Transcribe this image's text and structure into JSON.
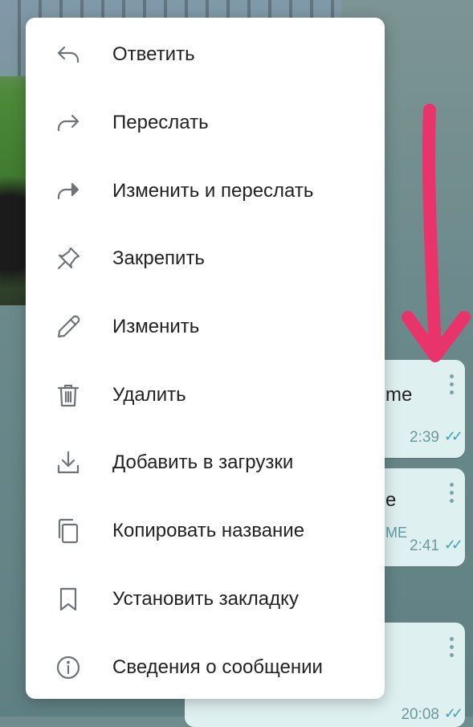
{
  "menu": {
    "items": [
      {
        "label": "Ответить",
        "icon": "reply-icon"
      },
      {
        "label": "Переслать",
        "icon": "forward-icon"
      },
      {
        "label": "Изменить и переслать",
        "icon": "edit-forward-icon"
      },
      {
        "label": "Закрепить",
        "icon": "pin-icon"
      },
      {
        "label": "Изменить",
        "icon": "pencil-icon"
      },
      {
        "label": "Удалить",
        "icon": "trash-icon"
      },
      {
        "label": "Добавить в загрузки",
        "icon": "download-icon"
      },
      {
        "label": "Копировать название",
        "icon": "copy-icon"
      },
      {
        "label": "Установить закладку",
        "icon": "bookmark-icon"
      },
      {
        "label": "Сведения о сообщении",
        "icon": "info-icon"
      }
    ]
  },
  "messages": [
    {
      "text": "me",
      "time": "2:39"
    },
    {
      "text": "e",
      "sub": "ME",
      "time": "2:41"
    },
    {
      "time": "20:08"
    }
  ],
  "colors": {
    "annotation": "#e8346a",
    "menu_bg": "#ffffff",
    "icon": "#6e7378"
  }
}
